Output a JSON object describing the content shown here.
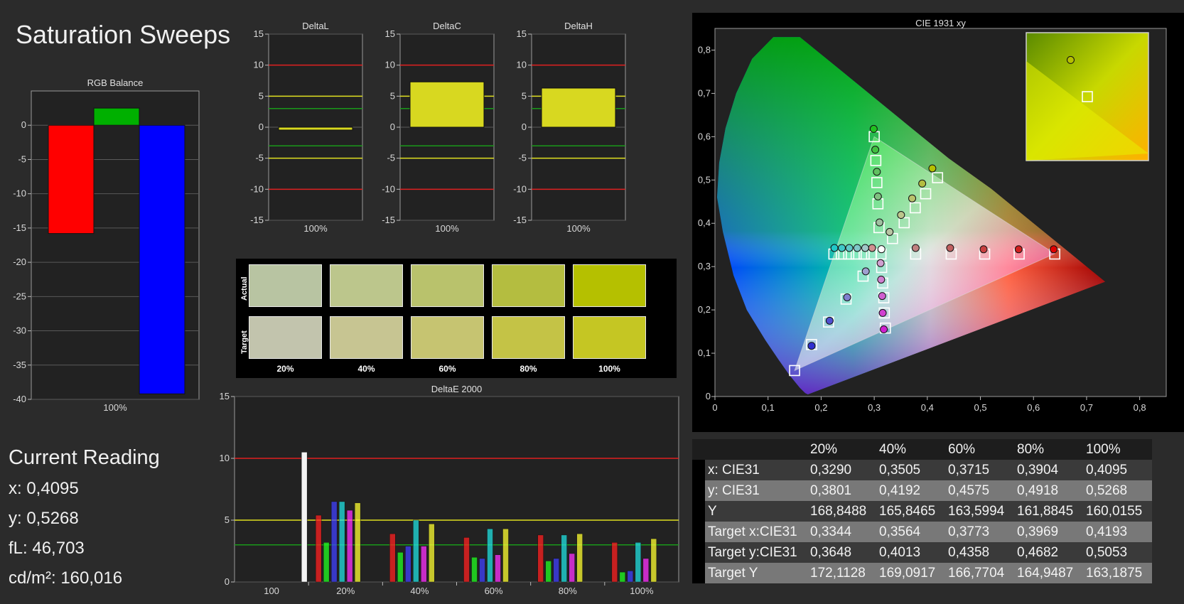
{
  "app": {
    "title": "Saturation Sweeps"
  },
  "current_reading": {
    "heading": "Current Reading",
    "x": "x: 0,4095",
    "y": "y: 0,5268",
    "fl": "fL: 46,703",
    "cdm2": "cd/m²: 160,016"
  },
  "swatches": {
    "actual_label": "Actual",
    "target_label": "Target",
    "columns": [
      "20%",
      "40%",
      "60%",
      "80%",
      "100%"
    ],
    "actual_colors": [
      "#b8c4a2",
      "#bcc68c",
      "#b9c26c",
      "#b4bd40",
      "#b5c000"
    ],
    "target_colors": [
      "#c2c4ad",
      "#c7c592",
      "#c6c471",
      "#c4c346",
      "#c5c623"
    ]
  },
  "table": {
    "columns": [
      "20%",
      "40%",
      "60%",
      "80%",
      "100%"
    ],
    "rows": [
      {
        "label": "x: CIE31",
        "values": [
          "0,3290",
          "0,3505",
          "0,3715",
          "0,3904",
          "0,4095"
        ]
      },
      {
        "label": "y: CIE31",
        "values": [
          "0,3801",
          "0,4192",
          "0,4575",
          "0,4918",
          "0,5268"
        ]
      },
      {
        "label": "Y",
        "values": [
          "168,8488",
          "165,8465",
          "163,5994",
          "161,8845",
          "160,0155"
        ]
      },
      {
        "label": "Target x:CIE31",
        "values": [
          "0,3344",
          "0,3564",
          "0,3773",
          "0,3969",
          "0,4193"
        ]
      },
      {
        "label": "Target y:CIE31",
        "values": [
          "0,3648",
          "0,4013",
          "0,4358",
          "0,4682",
          "0,5053"
        ]
      },
      {
        "label": "Target Y",
        "values": [
          "172,1128",
          "169,0917",
          "166,7704",
          "164,9487",
          "163,1875"
        ]
      }
    ]
  },
  "chart_data": [
    {
      "id": "rgb-balance",
      "type": "bar",
      "title": "RGB Balance",
      "categories": [
        "100%"
      ],
      "series": [
        {
          "color": "#ff0000",
          "values": [
            -15.8
          ]
        },
        {
          "color": "#00b000",
          "values": [
            2.5
          ]
        },
        {
          "color": "#0000ff",
          "values": [
            -39.2
          ]
        }
      ],
      "ylim": [
        -40,
        5
      ],
      "yticks": [
        "0",
        "-5",
        "-10",
        "-15",
        "-20",
        "-25",
        "-30",
        "-35",
        "-40"
      ],
      "ytick_values": [
        0,
        -5,
        -10,
        -15,
        -20,
        -25,
        -30,
        -35,
        -40
      ],
      "grid": true
    },
    {
      "id": "delta-l",
      "type": "bar",
      "title": "DeltaL",
      "categories": [
        "100%"
      ],
      "values": [
        -0.2
      ],
      "ylim": [
        -15,
        15
      ],
      "yticks": [
        "15",
        "10",
        "5",
        "0",
        "-5",
        "-10",
        "-15"
      ],
      "ytick_values": [
        15,
        10,
        5,
        0,
        -5,
        -10,
        -15
      ],
      "reference_lines": [
        {
          "value": 10,
          "color": "#e02020"
        },
        {
          "value": -10,
          "color": "#e02020"
        },
        {
          "value": 5,
          "color": "#e0e020"
        },
        {
          "value": -5,
          "color": "#e0e020"
        },
        {
          "value": 3,
          "color": "#1a9a1a"
        },
        {
          "value": -3,
          "color": "#1a9a1a"
        }
      ]
    },
    {
      "id": "delta-c",
      "type": "bar",
      "title": "DeltaC",
      "categories": [
        "100%"
      ],
      "values": [
        7.3
      ],
      "ylim": [
        -15,
        15
      ],
      "yticks": [
        "15",
        "10",
        "5",
        "0",
        "-5",
        "-10",
        "-15"
      ],
      "ytick_values": [
        15,
        10,
        5,
        0,
        -5,
        -10,
        -15
      ],
      "reference_lines": [
        {
          "value": 10,
          "color": "#e02020"
        },
        {
          "value": -10,
          "color": "#e02020"
        },
        {
          "value": 5,
          "color": "#e0e020"
        },
        {
          "value": -5,
          "color": "#e0e020"
        },
        {
          "value": 3,
          "color": "#1a9a1a"
        },
        {
          "value": -3,
          "color": "#1a9a1a"
        }
      ]
    },
    {
      "id": "delta-h",
      "type": "bar",
      "title": "DeltaH",
      "categories": [
        "100%"
      ],
      "values": [
        6.3
      ],
      "ylim": [
        -15,
        15
      ],
      "yticks": [
        "15",
        "10",
        "5",
        "0",
        "-5",
        "-10",
        "-15"
      ],
      "ytick_values": [
        15,
        10,
        5,
        0,
        -5,
        -10,
        -15
      ],
      "reference_lines": [
        {
          "value": 10,
          "color": "#e02020"
        },
        {
          "value": -10,
          "color": "#e02020"
        },
        {
          "value": 5,
          "color": "#e0e020"
        },
        {
          "value": -5,
          "color": "#e0e020"
        },
        {
          "value": 3,
          "color": "#1a9a1a"
        },
        {
          "value": -3,
          "color": "#1a9a1a"
        }
      ]
    },
    {
      "id": "delta-e",
      "type": "bar",
      "title": "DeltaE 2000",
      "categories": [
        "100",
        "20%",
        "40%",
        "60%",
        "80%",
        "100%"
      ],
      "series_colors": [
        "#ff2020",
        "#20ff20",
        "#4040ff",
        "#20e0e0",
        "#ff30ff",
        "#ffff30"
      ],
      "white_bar": {
        "category": "100",
        "value": 10.5
      },
      "groups": [
        {
          "category": "20%",
          "values": [
            5.4,
            3.2,
            6.5,
            6.5,
            5.8,
            6.4
          ]
        },
        {
          "category": "40%",
          "values": [
            3.9,
            2.4,
            2.9,
            5.0,
            2.9,
            4.7
          ]
        },
        {
          "category": "60%",
          "values": [
            3.6,
            2.0,
            1.9,
            4.3,
            2.2,
            4.3
          ]
        },
        {
          "category": "80%",
          "values": [
            3.8,
            1.7,
            1.9,
            3.8,
            2.3,
            3.9
          ]
        },
        {
          "category": "100%",
          "values": [
            3.2,
            0.8,
            0.9,
            3.2,
            1.9,
            3.5
          ]
        }
      ],
      "ylim": [
        0,
        15
      ],
      "yticks": [
        "15",
        "10",
        "5",
        "0"
      ],
      "ytick_values": [
        15,
        10,
        5,
        0
      ],
      "reference_lines": [
        {
          "value": 10,
          "color": "#e02020"
        },
        {
          "value": 5,
          "color": "#e0e020"
        },
        {
          "value": 3,
          "color": "#1a9a1a"
        }
      ]
    },
    {
      "id": "cie",
      "type": "scatter",
      "title": "CIE 1931 xy",
      "xlim": [
        0,
        0.85
      ],
      "ylim": [
        0,
        0.85
      ],
      "xticks": [
        "0",
        "0,1",
        "0,2",
        "0,3",
        "0,4",
        "0,5",
        "0,6",
        "0,7",
        "0,8"
      ],
      "xtick_values": [
        0,
        0.1,
        0.2,
        0.3,
        0.4,
        0.5,
        0.6,
        0.7,
        0.8
      ],
      "yticks": [
        "0",
        "0,1",
        "0,2",
        "0,3",
        "0,4",
        "0,5",
        "0,6",
        "0,7",
        "0,8"
      ],
      "ytick_values": [
        0,
        0.1,
        0.2,
        0.3,
        0.4,
        0.5,
        0.6,
        0.7,
        0.8
      ],
      "gamut_triangle": [
        [
          0.64,
          0.33
        ],
        [
          0.3,
          0.6
        ],
        [
          0.15,
          0.06
        ]
      ],
      "locus": [
        [
          0.175,
          0.005
        ],
        [
          0.17,
          0.008
        ],
        [
          0.16,
          0.02
        ],
        [
          0.14,
          0.05
        ],
        [
          0.12,
          0.085
        ],
        [
          0.095,
          0.13
        ],
        [
          0.06,
          0.2
        ],
        [
          0.035,
          0.28
        ],
        [
          0.015,
          0.38
        ],
        [
          0.004,
          0.46
        ],
        [
          0.008,
          0.54
        ],
        [
          0.02,
          0.62
        ],
        [
          0.04,
          0.7
        ],
        [
          0.07,
          0.78
        ],
        [
          0.11,
          0.83
        ],
        [
          0.16,
          0.83
        ],
        [
          0.23,
          0.76
        ],
        [
          0.3,
          0.69
        ],
        [
          0.37,
          0.62
        ],
        [
          0.44,
          0.55
        ],
        [
          0.52,
          0.48
        ],
        [
          0.6,
          0.4
        ],
        [
          0.66,
          0.34
        ],
        [
          0.735,
          0.265
        ]
      ],
      "measured_points": [
        {
          "x": 0.3136,
          "y": 0.3402,
          "color": "#ffffff"
        },
        {
          "x": 0.296,
          "y": 0.343,
          "color": "#d09090"
        },
        {
          "x": 0.378,
          "y": 0.343,
          "color": "#c08080"
        },
        {
          "x": 0.443,
          "y": 0.343,
          "color": "#c06060"
        },
        {
          "x": 0.506,
          "y": 0.34,
          "color": "#c84040"
        },
        {
          "x": 0.572,
          "y": 0.34,
          "color": "#d02020"
        },
        {
          "x": 0.638,
          "y": 0.34,
          "color": "#e00000"
        },
        {
          "x": 0.31,
          "y": 0.402,
          "color": "#a0c0a0"
        },
        {
          "x": 0.307,
          "y": 0.462,
          "color": "#80c080"
        },
        {
          "x": 0.305,
          "y": 0.519,
          "color": "#60c060"
        },
        {
          "x": 0.302,
          "y": 0.57,
          "color": "#40c040"
        },
        {
          "x": 0.299,
          "y": 0.618,
          "color": "#20c020"
        },
        {
          "x": 0.284,
          "y": 0.289,
          "color": "#a0a0d0"
        },
        {
          "x": 0.249,
          "y": 0.229,
          "color": "#8080d0"
        },
        {
          "x": 0.216,
          "y": 0.175,
          "color": "#5050d0"
        },
        {
          "x": 0.182,
          "y": 0.117,
          "color": "#3030d0"
        },
        {
          "x": 0.283,
          "y": 0.343,
          "color": "#a0c8c8"
        },
        {
          "x": 0.268,
          "y": 0.343,
          "color": "#80c8c8"
        },
        {
          "x": 0.253,
          "y": 0.343,
          "color": "#60c8c8"
        },
        {
          "x": 0.239,
          "y": 0.343,
          "color": "#40c8c8"
        },
        {
          "x": 0.225,
          "y": 0.343,
          "color": "#20c8c8"
        },
        {
          "x": 0.312,
          "y": 0.308,
          "color": "#d0a0d0"
        },
        {
          "x": 0.313,
          "y": 0.27,
          "color": "#d080d0"
        },
        {
          "x": 0.315,
          "y": 0.232,
          "color": "#d060d0"
        },
        {
          "x": 0.316,
          "y": 0.193,
          "color": "#d040d0"
        },
        {
          "x": 0.318,
          "y": 0.155,
          "color": "#d020d0"
        },
        {
          "x": 0.329,
          "y": 0.38,
          "color": "#b8c4a2"
        },
        {
          "x": 0.3505,
          "y": 0.4192,
          "color": "#bcc68c"
        },
        {
          "x": 0.3715,
          "y": 0.4575,
          "color": "#b9c26c"
        },
        {
          "x": 0.3904,
          "y": 0.4918,
          "color": "#b4bd40"
        },
        {
          "x": 0.4095,
          "y": 0.5268,
          "color": "#b5c000"
        }
      ],
      "target_points": [
        [
          0.3127,
          0.329
        ],
        [
          0.295,
          0.329
        ],
        [
          0.378,
          0.329
        ],
        [
          0.445,
          0.329
        ],
        [
          0.508,
          0.329
        ],
        [
          0.573,
          0.329
        ],
        [
          0.64,
          0.329
        ],
        [
          0.309,
          0.39
        ],
        [
          0.307,
          0.445
        ],
        [
          0.305,
          0.494
        ],
        [
          0.303,
          0.545
        ],
        [
          0.3,
          0.6
        ],
        [
          0.279,
          0.278
        ],
        [
          0.247,
          0.225
        ],
        [
          0.214,
          0.172
        ],
        [
          0.182,
          0.12
        ],
        [
          0.15,
          0.06
        ],
        [
          0.281,
          0.329
        ],
        [
          0.266,
          0.329
        ],
        [
          0.252,
          0.329
        ],
        [
          0.238,
          0.329
        ],
        [
          0.224,
          0.329
        ],
        [
          0.314,
          0.298
        ],
        [
          0.316,
          0.262
        ],
        [
          0.318,
          0.228
        ],
        [
          0.319,
          0.193
        ],
        [
          0.321,
          0.158
        ],
        [
          0.3344,
          0.3648
        ],
        [
          0.3564,
          0.4013
        ],
        [
          0.3773,
          0.4358
        ],
        [
          0.3969,
          0.4682
        ],
        [
          0.4193,
          0.5053
        ]
      ]
    }
  ]
}
